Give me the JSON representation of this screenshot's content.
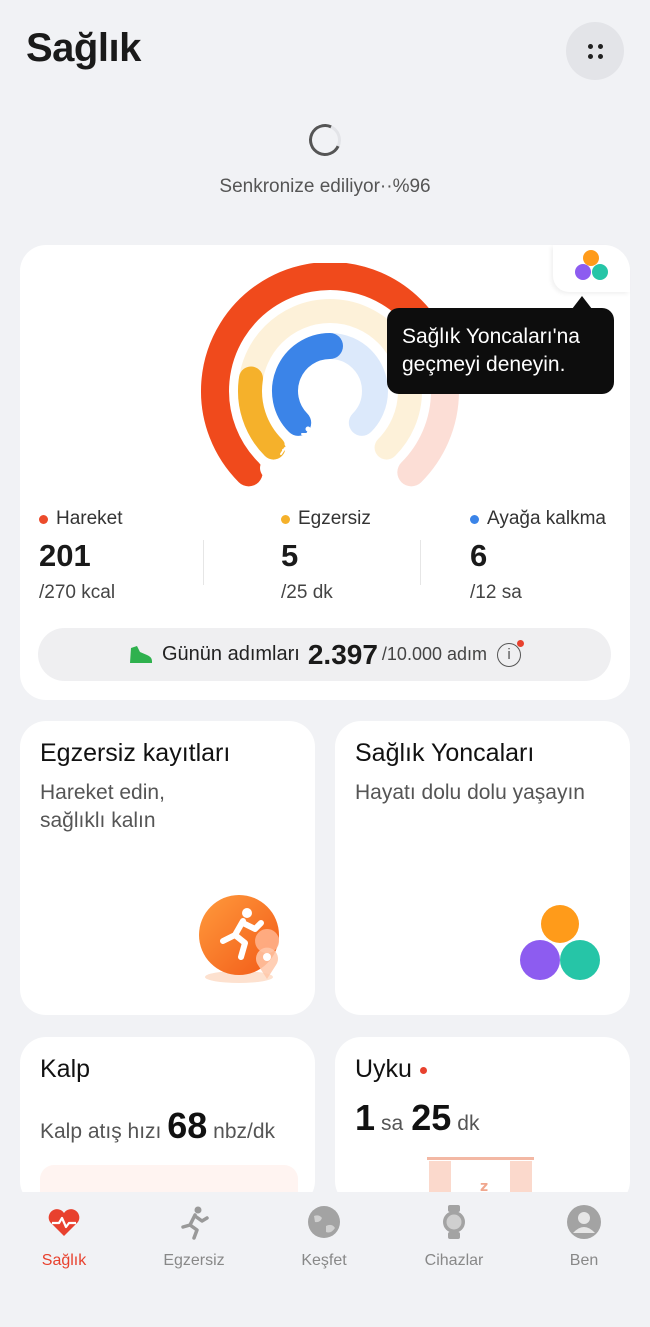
{
  "header": {
    "title": "Sağlık"
  },
  "sync": {
    "text": "Senkronize ediliyor··%96",
    "progress_percent": 96
  },
  "tooltip": {
    "text": "Sağlık Yoncaları'na geçmeyi deneyin."
  },
  "activity": {
    "rings": [
      {
        "name": "Hareket",
        "value": 201,
        "goal": 270,
        "color": "#f04a1c"
      },
      {
        "name": "Egzersiz",
        "value": 5,
        "goal": 25,
        "color": "#f5b12b"
      },
      {
        "name": "Ayağa kalkma",
        "value": 6,
        "goal": 12,
        "color": "#3b84e8"
      }
    ],
    "move": {
      "label": "Hareket",
      "value": "201",
      "goal": "/270 kcal",
      "color": "#ec4b2b"
    },
    "exercise": {
      "label": "Egzersiz",
      "value": "5",
      "goal": "/25 dk",
      "color": "#f5b12b"
    },
    "stand": {
      "label": "Ayağa kalkma",
      "value": "6",
      "goal": "/12 sa",
      "color": "#3b84e8"
    }
  },
  "steps": {
    "label": "Günün adımları",
    "value": "2.397",
    "goal": "/10.000 adım",
    "info_icon": "i"
  },
  "tiles": {
    "workout": {
      "title": "Egzersiz kayıtları",
      "subtitle_line1": "Hareket edin,",
      "subtitle_line2": "sağlıklı kalın"
    },
    "clovers": {
      "title": "Sağlık Yoncaları",
      "subtitle": "Hayatı dolu dolu yaşayın"
    },
    "heart": {
      "title": "Kalp",
      "label": "Kalp atış hızı",
      "value": "68",
      "unit": "nbz/dk"
    },
    "sleep": {
      "title": "Uyku",
      "hours": "1",
      "hours_unit": "sa",
      "minutes": "25",
      "minutes_unit": "dk"
    }
  },
  "nav": [
    {
      "label": "Sağlık",
      "icon": "heart-pulse-icon",
      "active": true
    },
    {
      "label": "Egzersiz",
      "icon": "runner-icon",
      "active": false
    },
    {
      "label": "Keşfet",
      "icon": "globe-icon",
      "active": false
    },
    {
      "label": "Cihazlar",
      "icon": "watch-icon",
      "active": false
    },
    {
      "label": "Ben",
      "icon": "user-icon",
      "active": false
    }
  ],
  "colors": {
    "accent": "#e8412e",
    "background": "#f1f2f5",
    "card": "#ffffff"
  }
}
